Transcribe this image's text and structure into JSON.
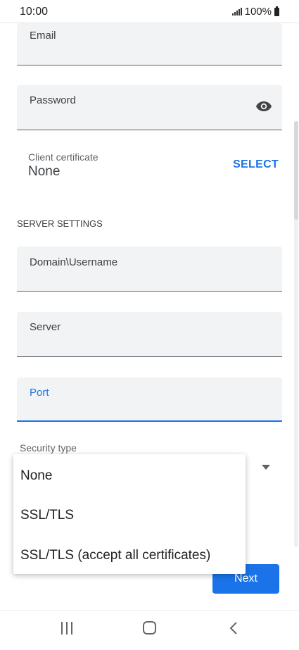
{
  "status": {
    "time": "10:00",
    "battery": "100%"
  },
  "fields": {
    "email_label": "Email",
    "password_label": "Password",
    "domain_username_label": "Domain\\Username",
    "server_label": "Server",
    "port_label": "Port"
  },
  "certificate": {
    "label": "Client certificate",
    "value": "None",
    "select": "SELECT"
  },
  "server_settings_title": "SERVER SETTINGS",
  "security": {
    "label": "Security type",
    "options": [
      "None",
      "SSL/TLS",
      "SSL/TLS (accept all certificates)"
    ]
  },
  "next_button": "Next",
  "colors": {
    "accent": "#1a73e8",
    "field_bg": "#f1f3f4"
  }
}
